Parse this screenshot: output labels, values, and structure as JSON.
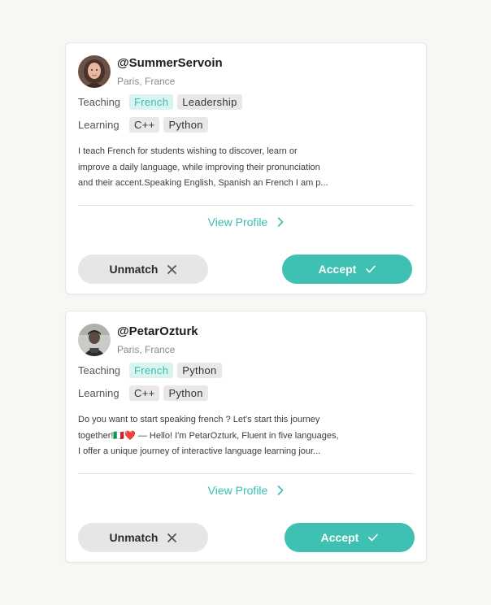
{
  "colors": {
    "accent": "#3ec1b3",
    "accent_text": "#3bbdb0",
    "tag_highlight_bg": "#d9f4f0",
    "tag_bg": "#e8e8e8"
  },
  "matches": [
    {
      "username": "@SummerServoin",
      "location": "Paris, France",
      "teaching_label": "Teaching",
      "teaching": [
        "French",
        "Leadership"
      ],
      "learning_label": "Learning",
      "learning": [
        "C++",
        "Python"
      ],
      "description": [
        "I teach French for students wishing to discover, learn or",
        "improve a daily language, while improving their pronunciation",
        "and their accent.Speaking English, Spanish an French I am p..."
      ],
      "view_profile": "View Profile",
      "unmatch": "Unmatch",
      "accept": "Accept",
      "avatar_icon": "avatar-photo-woman"
    },
    {
      "username": "@PetarOzturk",
      "location": "Paris, France",
      "teaching_label": "Teaching",
      "teaching": [
        "French",
        "Python"
      ],
      "learning_label": "Learning",
      "learning": [
        "C++",
        "Python"
      ],
      "description": [
        "Do you want to start speaking french ? Let's start this journey",
        "together!🇮🇹❤️ — Hello! I'm PetarOzturk, Fluent in five languages,",
        "I offer a unique journey of interactive language learning jour..."
      ],
      "view_profile": "View Profile",
      "unmatch": "Unmatch",
      "accept": "Accept",
      "avatar_icon": "avatar-photo-man"
    }
  ]
}
